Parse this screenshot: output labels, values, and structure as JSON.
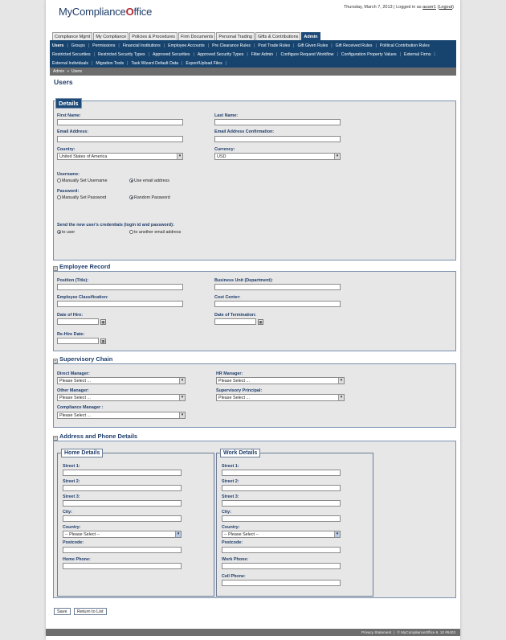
{
  "logo": {
    "text": "MyCompliance",
    "suffix": "ffice",
    "mark": "O"
  },
  "header": {
    "date": "Thursday, March 7, 2013",
    "logged_in_label": "Logged in as",
    "user": "auser1",
    "logout": "Logout"
  },
  "main_tabs": [
    "Compliance Mgmt",
    "My Compliance",
    "Policies & Procedures",
    "Firm Documents",
    "Personal Trading",
    "Gifts & Contributions",
    "Admin"
  ],
  "subnav": {
    "row1": [
      "Users",
      "Groups",
      "Permissions",
      "Financial Institutions",
      "Employee Accounts",
      "Pre Clearance Rules",
      "Post Trade Rules",
      "Gift Given Rules",
      "Gift Received Rules",
      "Political Contribution Rules"
    ],
    "row2": [
      "Restricted Securities",
      "Restricted Security Types",
      "Approved Securities",
      "Approved Security Types",
      "Filter Admin",
      "Configure Request Workflow",
      "Configuration Property Values",
      "External Firms"
    ],
    "row3": [
      "External Individuals",
      "Migration Tools",
      "Task Wizard Default Data",
      "Export/Upload Files"
    ]
  },
  "breadcrumb": {
    "admin": "Admin",
    "sep": "»",
    "current": "Users"
  },
  "page_title": "Users",
  "details": {
    "title": "Details",
    "first_name": "First Name:",
    "last_name": "Last Name:",
    "email": "Email Address:",
    "email_confirm": "Email Address Confirmation:",
    "country": "Country:",
    "country_value": "United States of America",
    "currency": "Currency:",
    "currency_value": "USD",
    "username": "Username:",
    "manual_username": "Manually Set Username",
    "use_email": "Use email address",
    "password": "Password:",
    "manual_password": "Manually Set Password",
    "random_password": "Random Password",
    "send_creds": "Send the new user's credentials (login id and password):",
    "to_user": "to user",
    "to_other": "to another email address"
  },
  "employee": {
    "title": "Employee Record",
    "position": "Position (Title):",
    "business_unit": "Business Unit (Department):",
    "classification": "Employee Classification:",
    "cost_center": "Cost Center:",
    "hire": "Date of Hire:",
    "termination": "Date of Termination:",
    "rehire": "Re-Hire Date:"
  },
  "supervisory": {
    "title": "Supervisory Chain",
    "direct": "Direct Manager:",
    "hr": "HR Manager:",
    "other": "Other Manager:",
    "principal": "Supervisory Principal:",
    "compliance": "Compliance Manager :",
    "placeholder": "Please Select ..."
  },
  "address": {
    "title": "Address and Phone Details",
    "home": {
      "title": "Home Details",
      "street1": "Street 1:",
      "street2": "Street 2:",
      "street3": "Street 3:",
      "city": "City:",
      "country": "Country:",
      "country_value": "-- Please Select --",
      "postcode": "Postcode:",
      "phone": "Home Phone:"
    },
    "work": {
      "title": "Work Details",
      "street1": "Street 1:",
      "street2": "Street 2:",
      "street3": "Street 3:",
      "city": "City:",
      "country": "Country:",
      "country_value": "-- Please Select --",
      "postcode": "Postcode:",
      "phone": "Work Phone:",
      "cell": "Cell Phone:"
    }
  },
  "buttons": {
    "save": "Save",
    "return": "Return to List"
  },
  "footer": {
    "privacy": "Privacy Statement",
    "copyright": "© MyComplianceOffice 6. 10 #6403"
  },
  "icons": {
    "dropdown": "chevron-down-icon",
    "calendar": "calendar-icon",
    "collapse": "collapse-icon"
  },
  "colors": {
    "nav": "#17446f",
    "accent": "#1f3d6b",
    "logo_tick": "#b3262a",
    "panel": "#e7e7e7"
  }
}
